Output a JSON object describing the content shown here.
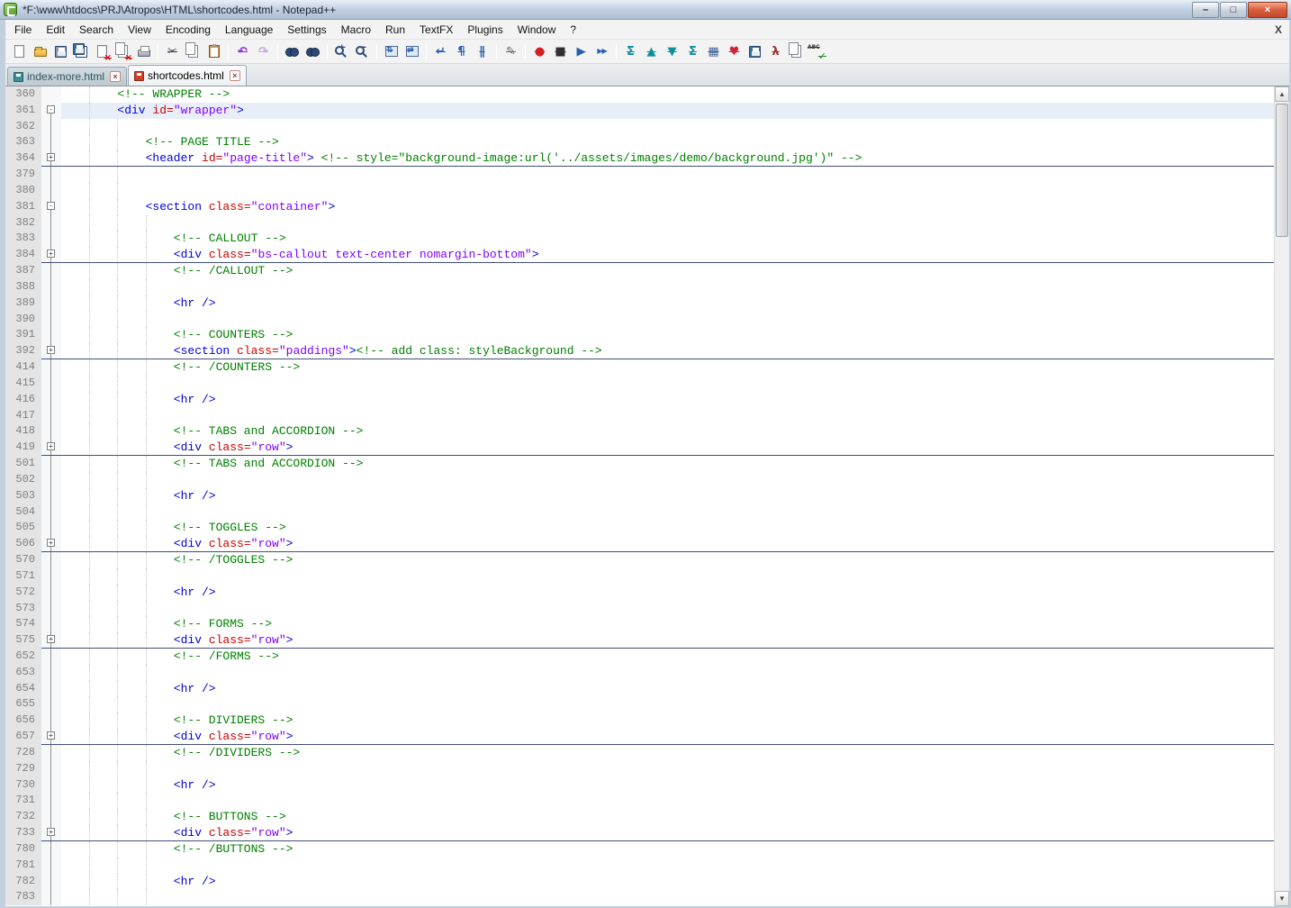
{
  "window": {
    "title": "*F:\\www\\htdocs\\PRJ\\Atropos\\HTML\\shortcodes.html - Notepad++",
    "controls": [
      {
        "name": "minimize",
        "glyph": "–"
      },
      {
        "name": "maximize",
        "glyph": "□"
      },
      {
        "name": "close",
        "glyph": "×"
      }
    ]
  },
  "menu": {
    "items": [
      "File",
      "Edit",
      "Search",
      "View",
      "Encoding",
      "Language",
      "Settings",
      "Macro",
      "Run",
      "TextFX",
      "Plugins",
      "Window",
      "?"
    ],
    "close_label": "X"
  },
  "toolbar": {
    "items": [
      {
        "name": "new-file",
        "kind": "page"
      },
      {
        "name": "open-folder",
        "kind": "folder"
      },
      {
        "name": "save",
        "kind": "floppy",
        "color": "#8a97ab"
      },
      {
        "name": "save-all",
        "kind": "floppy2"
      },
      {
        "name": "close-file",
        "kind": "pagex",
        "glyph": "×"
      },
      {
        "name": "close-all-files",
        "kind": "pagex2",
        "glyph": "×"
      },
      {
        "name": "print",
        "kind": "printer"
      },
      {
        "kind": "sep"
      },
      {
        "name": "cut",
        "kind": "glyph",
        "glyph": "✂",
        "color": "#444455"
      },
      {
        "name": "copy",
        "kind": "page2"
      },
      {
        "name": "paste",
        "kind": "clipboard"
      },
      {
        "kind": "sep"
      },
      {
        "name": "undo",
        "kind": "glyph",
        "glyph": "↶",
        "color": "#8a2be2"
      },
      {
        "name": "redo",
        "kind": "glyph",
        "glyph": "↷",
        "color": "#c3a8e0"
      },
      {
        "kind": "sep"
      },
      {
        "name": "find",
        "kind": "binoc"
      },
      {
        "name": "replace",
        "kind": "binoc"
      },
      {
        "kind": "sep"
      },
      {
        "name": "zoom-in",
        "kind": "zoom",
        "glyph": "+"
      },
      {
        "name": "zoom-out",
        "kind": "zoom",
        "glyph": "−"
      },
      {
        "kind": "sep"
      },
      {
        "name": "sync-vertical-scrolling",
        "kind": "sync",
        "glyph": "⇅"
      },
      {
        "name": "sync-horizontal-scrolling",
        "kind": "sync",
        "glyph": "⇄"
      },
      {
        "kind": "sep"
      },
      {
        "name": "word-wrap",
        "kind": "glyph",
        "glyph": "↵",
        "color": "#2b5fb0"
      },
      {
        "name": "show-all-characters",
        "kind": "glyph",
        "glyph": "¶",
        "color": "#2b5fb0"
      },
      {
        "name": "show-indent-guide",
        "kind": "glyph",
        "glyph": "∥",
        "color": "#2b5fb0"
      },
      {
        "kind": "sep"
      },
      {
        "name": "user-defined-dialog",
        "kind": "glyph",
        "glyph": "✎",
        "color": "#6a6a6a"
      },
      {
        "kind": "sep"
      },
      {
        "name": "macro-record",
        "kind": "glyph",
        "glyph": "●",
        "color": "#d02020"
      },
      {
        "name": "macro-stop",
        "kind": "glyph",
        "glyph": "■",
        "color": "#303030"
      },
      {
        "name": "macro-playback",
        "kind": "glyph",
        "glyph": "▶",
        "color": "#2b5fb0"
      },
      {
        "name": "macro-run-multiple",
        "kind": "glyph2",
        "glyph": "▶▶",
        "color": "#2b5fb0"
      },
      {
        "kind": "sep"
      },
      {
        "name": "textfx-sigma",
        "kind": "glyph",
        "glyph": "Σ",
        "color": "#0e8f9e"
      },
      {
        "name": "textfx-sort-ascending",
        "kind": "glyph",
        "glyph": "▲",
        "color": "#0e8f9e"
      },
      {
        "name": "textfx-sort-descending",
        "kind": "glyph",
        "glyph": "▼",
        "color": "#0e8f9e"
      },
      {
        "name": "textfx-sum",
        "kind": "glyph",
        "glyph": "Σ",
        "color": "#0e8f9e"
      },
      {
        "name": "compare-plugin",
        "kind": "glyph",
        "glyph": "▦",
        "color": "#4a6a9a"
      },
      {
        "name": "favorites-plugin",
        "kind": "glyph",
        "glyph": "♥",
        "color": "#cc2233"
      },
      {
        "name": "session-save-plugin",
        "kind": "floppy",
        "color": "#3a6ea5"
      },
      {
        "name": "function-list-plugin",
        "kind": "glyph",
        "glyph": "λ",
        "color": "#993333"
      },
      {
        "name": "export-plugin",
        "kind": "page2"
      },
      {
        "name": "spell-check",
        "kind": "spell",
        "glyph": "✓",
        "color": "#2a8a2a",
        "label": "ABC"
      }
    ]
  },
  "tabs": [
    {
      "label": "index-more.html",
      "state": "saved",
      "active": false,
      "close_glyph": "×"
    },
    {
      "label": "shortcodes.html",
      "state": "modified",
      "active": true,
      "close_glyph": "×"
    }
  ],
  "editor": {
    "palette": {
      "comment": "#008000",
      "tag": "#0000e0",
      "attribute": "#cc0000",
      "value": "#8000ff",
      "text": "#000000",
      "fold_line": "#41507a",
      "current_line_bg": "#e8eef8",
      "margin_bg": "#e4e4e4",
      "margin_text": "#808080"
    },
    "scrollbar": {
      "up": "▲",
      "down": "▼"
    },
    "lines": [
      {
        "n": 360,
        "ind": 8,
        "g": 1,
        "fold": "none",
        "seg": [
          [
            "c",
            "<!-- WRAPPER -->"
          ]
        ]
      },
      {
        "n": 361,
        "ind": 8,
        "g": 1,
        "fold": "start",
        "cur": true,
        "seg": [
          [
            "t",
            "<div"
          ],
          [
            "p",
            " "
          ],
          [
            "a",
            "id="
          ],
          [
            "v",
            "\"wrapper\""
          ],
          [
            "t",
            ">"
          ]
        ]
      },
      {
        "n": 362,
        "ind": 0,
        "g": 2,
        "fold": "line",
        "seg": []
      },
      {
        "n": 363,
        "ind": 12,
        "g": 2,
        "fold": "line",
        "seg": [
          [
            "c",
            "<!-- PAGE TITLE -->"
          ]
        ]
      },
      {
        "n": 364,
        "ind": 12,
        "g": 2,
        "fold": "closed",
        "seg": [
          [
            "t",
            "<header"
          ],
          [
            "p",
            " "
          ],
          [
            "a",
            "id="
          ],
          [
            "v",
            "\"page-title\""
          ],
          [
            "t",
            ">"
          ],
          [
            "p",
            " "
          ],
          [
            "c",
            "<!-- style=\"background-image:url('../assets/images/demo/background.jpg')\" -->"
          ]
        ]
      },
      {
        "n": 379,
        "ind": 0,
        "g": 2,
        "fold": "line",
        "seg": []
      },
      {
        "n": 380,
        "ind": 0,
        "g": 2,
        "fold": "line",
        "seg": []
      },
      {
        "n": 381,
        "ind": 12,
        "g": 2,
        "fold": "open",
        "seg": [
          [
            "t",
            "<section"
          ],
          [
            "p",
            " "
          ],
          [
            "a",
            "class="
          ],
          [
            "v",
            "\"container\""
          ],
          [
            "t",
            ">"
          ]
        ]
      },
      {
        "n": 382,
        "ind": 0,
        "g": 3,
        "fold": "line",
        "seg": []
      },
      {
        "n": 383,
        "ind": 16,
        "g": 3,
        "fold": "line",
        "seg": [
          [
            "c",
            "<!-- CALLOUT -->"
          ]
        ]
      },
      {
        "n": 384,
        "ind": 16,
        "g": 3,
        "fold": "closed",
        "seg": [
          [
            "t",
            "<div"
          ],
          [
            "p",
            " "
          ],
          [
            "a",
            "class="
          ],
          [
            "v",
            "\"bs-callout text-center nomargin-bottom\""
          ],
          [
            "t",
            ">"
          ]
        ]
      },
      {
        "n": 387,
        "ind": 16,
        "g": 3,
        "fold": "line",
        "seg": [
          [
            "c",
            "<!-- /CALLOUT -->"
          ]
        ]
      },
      {
        "n": 388,
        "ind": 0,
        "g": 3,
        "fold": "line",
        "seg": []
      },
      {
        "n": 389,
        "ind": 16,
        "g": 3,
        "fold": "line",
        "seg": [
          [
            "t",
            "<hr />"
          ]
        ]
      },
      {
        "n": 390,
        "ind": 0,
        "g": 3,
        "fold": "line",
        "seg": []
      },
      {
        "n": 391,
        "ind": 16,
        "g": 3,
        "fold": "line",
        "seg": [
          [
            "c",
            "<!-- COUNTERS -->"
          ]
        ]
      },
      {
        "n": 392,
        "ind": 16,
        "g": 3,
        "fold": "closed",
        "seg": [
          [
            "t",
            "<section"
          ],
          [
            "p",
            " "
          ],
          [
            "a",
            "class="
          ],
          [
            "v",
            "\"paddings\""
          ],
          [
            "t",
            ">"
          ],
          [
            "c",
            "<!-- add class: styleBackground -->"
          ]
        ]
      },
      {
        "n": 414,
        "ind": 16,
        "g": 3,
        "fold": "line",
        "seg": [
          [
            "c",
            "<!-- /COUNTERS -->"
          ]
        ]
      },
      {
        "n": 415,
        "ind": 0,
        "g": 3,
        "fold": "line",
        "seg": []
      },
      {
        "n": 416,
        "ind": 16,
        "g": 3,
        "fold": "line",
        "seg": [
          [
            "t",
            "<hr />"
          ]
        ]
      },
      {
        "n": 417,
        "ind": 0,
        "g": 3,
        "fold": "line",
        "seg": []
      },
      {
        "n": 418,
        "ind": 16,
        "g": 3,
        "fold": "line",
        "seg": [
          [
            "c",
            "<!-- TABS and ACCORDION -->"
          ]
        ]
      },
      {
        "n": 419,
        "ind": 16,
        "g": 3,
        "fold": "closed",
        "seg": [
          [
            "t",
            "<div"
          ],
          [
            "p",
            " "
          ],
          [
            "a",
            "class="
          ],
          [
            "v",
            "\"row\""
          ],
          [
            "t",
            ">"
          ]
        ]
      },
      {
        "n": 501,
        "ind": 16,
        "g": 3,
        "fold": "line",
        "seg": [
          [
            "c",
            "<!-- TABS and ACCORDION -->"
          ]
        ]
      },
      {
        "n": 502,
        "ind": 0,
        "g": 3,
        "fold": "line",
        "seg": []
      },
      {
        "n": 503,
        "ind": 16,
        "g": 3,
        "fold": "line",
        "seg": [
          [
            "t",
            "<hr />"
          ]
        ]
      },
      {
        "n": 504,
        "ind": 0,
        "g": 3,
        "fold": "line",
        "seg": []
      },
      {
        "n": 505,
        "ind": 16,
        "g": 3,
        "fold": "line",
        "seg": [
          [
            "c",
            "<!-- TOGGLES -->"
          ]
        ]
      },
      {
        "n": 506,
        "ind": 16,
        "g": 3,
        "fold": "closed",
        "seg": [
          [
            "t",
            "<div"
          ],
          [
            "p",
            " "
          ],
          [
            "a",
            "class="
          ],
          [
            "v",
            "\"row\""
          ],
          [
            "t",
            ">"
          ]
        ]
      },
      {
        "n": 570,
        "ind": 16,
        "g": 3,
        "fold": "line",
        "seg": [
          [
            "c",
            "<!-- /TOGGLES -->"
          ]
        ]
      },
      {
        "n": 571,
        "ind": 0,
        "g": 3,
        "fold": "line",
        "seg": []
      },
      {
        "n": 572,
        "ind": 16,
        "g": 3,
        "fold": "line",
        "seg": [
          [
            "t",
            "<hr />"
          ]
        ]
      },
      {
        "n": 573,
        "ind": 0,
        "g": 3,
        "fold": "line",
        "seg": []
      },
      {
        "n": 574,
        "ind": 16,
        "g": 3,
        "fold": "line",
        "seg": [
          [
            "c",
            "<!-- FORMS -->"
          ]
        ]
      },
      {
        "n": 575,
        "ind": 16,
        "g": 3,
        "fold": "closed",
        "seg": [
          [
            "t",
            "<div"
          ],
          [
            "p",
            " "
          ],
          [
            "a",
            "class="
          ],
          [
            "v",
            "\"row\""
          ],
          [
            "t",
            ">"
          ]
        ]
      },
      {
        "n": 652,
        "ind": 16,
        "g": 3,
        "fold": "line",
        "seg": [
          [
            "c",
            "<!-- /FORMS -->"
          ]
        ]
      },
      {
        "n": 653,
        "ind": 0,
        "g": 3,
        "fold": "line",
        "seg": []
      },
      {
        "n": 654,
        "ind": 16,
        "g": 3,
        "fold": "line",
        "seg": [
          [
            "t",
            "<hr />"
          ]
        ]
      },
      {
        "n": 655,
        "ind": 0,
        "g": 3,
        "fold": "line",
        "seg": []
      },
      {
        "n": 656,
        "ind": 16,
        "g": 3,
        "fold": "line",
        "seg": [
          [
            "c",
            "<!-- DIVIDERS -->"
          ]
        ]
      },
      {
        "n": 657,
        "ind": 16,
        "g": 3,
        "fold": "closed",
        "seg": [
          [
            "t",
            "<div"
          ],
          [
            "p",
            " "
          ],
          [
            "a",
            "class="
          ],
          [
            "v",
            "\"row\""
          ],
          [
            "t",
            ">"
          ]
        ]
      },
      {
        "n": 728,
        "ind": 16,
        "g": 3,
        "fold": "line",
        "seg": [
          [
            "c",
            "<!-- /DIVIDERS -->"
          ]
        ]
      },
      {
        "n": 729,
        "ind": 0,
        "g": 3,
        "fold": "line",
        "seg": []
      },
      {
        "n": 730,
        "ind": 16,
        "g": 3,
        "fold": "line",
        "seg": [
          [
            "t",
            "<hr />"
          ]
        ]
      },
      {
        "n": 731,
        "ind": 0,
        "g": 3,
        "fold": "line",
        "seg": []
      },
      {
        "n": 732,
        "ind": 16,
        "g": 3,
        "fold": "line",
        "seg": [
          [
            "c",
            "<!-- BUTTONS -->"
          ]
        ]
      },
      {
        "n": 733,
        "ind": 16,
        "g": 3,
        "fold": "closed",
        "seg": [
          [
            "t",
            "<div"
          ],
          [
            "p",
            " "
          ],
          [
            "a",
            "class="
          ],
          [
            "v",
            "\"row\""
          ],
          [
            "t",
            ">"
          ]
        ]
      },
      {
        "n": 780,
        "ind": 16,
        "g": 3,
        "fold": "line",
        "seg": [
          [
            "c",
            "<!-- /BUTTONS -->"
          ]
        ]
      },
      {
        "n": 781,
        "ind": 0,
        "g": 3,
        "fold": "line",
        "seg": []
      },
      {
        "n": 782,
        "ind": 16,
        "g": 3,
        "fold": "line",
        "seg": [
          [
            "t",
            "<hr />"
          ]
        ]
      },
      {
        "n": 783,
        "ind": 0,
        "g": 3,
        "fold": "line",
        "seg": []
      }
    ]
  }
}
